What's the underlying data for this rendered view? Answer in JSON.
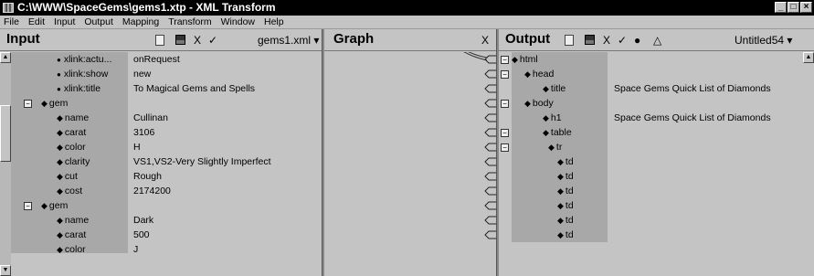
{
  "window": {
    "title": "C:\\WWW\\SpaceGems\\gems1.xtp - XML Transform"
  },
  "menu": [
    "File",
    "Edit",
    "Input",
    "Output",
    "Mapping",
    "Transform",
    "Window",
    "Help"
  ],
  "input": {
    "title": "Input",
    "file": "gems1.xml",
    "rows": [
      {
        "label": "xlink:actu...",
        "value": "onRequest",
        "kind": "attr"
      },
      {
        "label": "xlink:show",
        "value": "new",
        "kind": "attr"
      },
      {
        "label": "xlink:title",
        "value": "To Magical Gems and Spells",
        "kind": "attr"
      },
      {
        "label": "gem",
        "value": "",
        "kind": "group"
      },
      {
        "label": "name",
        "value": "Cullinan",
        "kind": "node"
      },
      {
        "label": "carat",
        "value": "3106",
        "kind": "node"
      },
      {
        "label": "color",
        "value": "H",
        "kind": "node"
      },
      {
        "label": "clarity",
        "value": "VS1,VS2-Very Slightly Imperfect",
        "kind": "node"
      },
      {
        "label": "cut",
        "value": "Rough",
        "kind": "node"
      },
      {
        "label": "cost",
        "value": "2174200",
        "kind": "node"
      },
      {
        "label": "gem",
        "value": "",
        "kind": "group"
      },
      {
        "label": "name",
        "value": "Dark",
        "kind": "node"
      },
      {
        "label": "carat",
        "value": "500",
        "kind": "node"
      },
      {
        "label": "color",
        "value": "J",
        "kind": "node"
      }
    ]
  },
  "graph": {
    "title": "Graph",
    "close": "X"
  },
  "output": {
    "title": "Output",
    "file": "Untitled54",
    "rows": [
      {
        "label": "html",
        "value": "",
        "depth": 0,
        "expander": true
      },
      {
        "label": "head",
        "value": "",
        "depth": 1,
        "expander": true
      },
      {
        "label": "title",
        "value": "Space Gems Quick List of Diamonds",
        "depth": 2,
        "expander": false
      },
      {
        "label": "body",
        "value": "",
        "depth": 1,
        "expander": true
      },
      {
        "label": "h1",
        "value": "Space Gems Quick List of Diamonds",
        "depth": 2,
        "expander": false
      },
      {
        "label": "table",
        "value": "",
        "depth": 2,
        "expander": true
      },
      {
        "label": "tr",
        "value": "",
        "depth": 3,
        "expander": true
      },
      {
        "label": "td",
        "value": "",
        "depth": 4,
        "expander": false
      },
      {
        "label": "td",
        "value": "",
        "depth": 4,
        "expander": false
      },
      {
        "label": "td",
        "value": "",
        "depth": 4,
        "expander": false
      },
      {
        "label": "td",
        "value": "",
        "depth": 4,
        "expander": false
      },
      {
        "label": "td",
        "value": "",
        "depth": 4,
        "expander": false
      },
      {
        "label": "td",
        "value": "",
        "depth": 4,
        "expander": false
      }
    ]
  }
}
